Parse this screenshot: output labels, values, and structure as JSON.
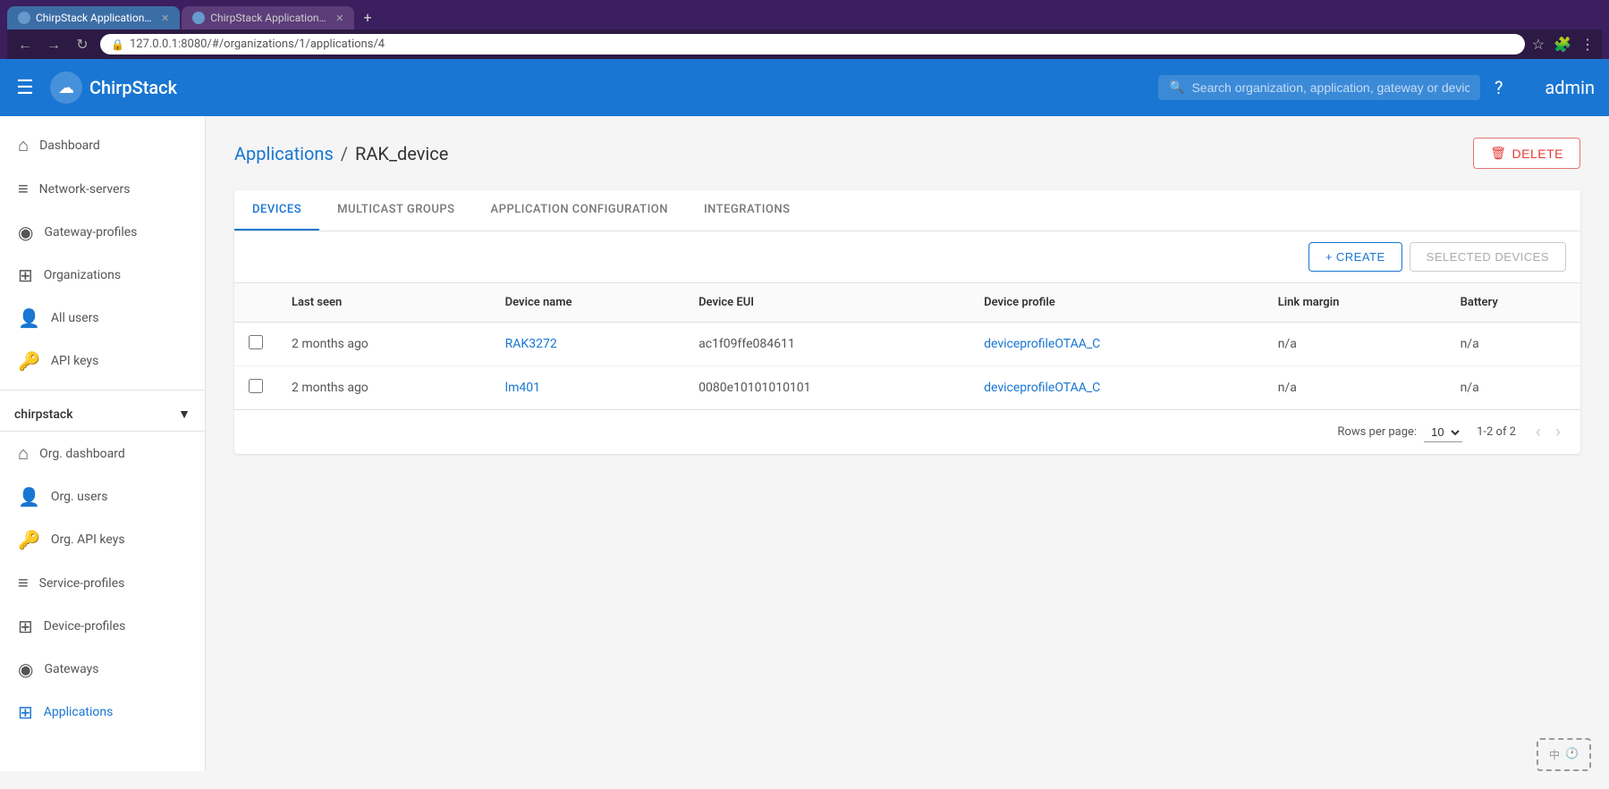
{
  "browser": {
    "tabs": [
      {
        "id": "tab1",
        "title": "ChirpStack Application S...",
        "active": true,
        "favicon": "🌐"
      },
      {
        "id": "tab2",
        "title": "ChirpStack Application S...",
        "active": false,
        "favicon": "🌐"
      }
    ],
    "address": "127.0.0.1:8080/#/organizations/1/applications/4",
    "new_tab_label": "+"
  },
  "appbar": {
    "logo_text": "ChirpStack",
    "search_placeholder": "Search organization, application, gateway or device",
    "user_label": "admin",
    "help_icon": "?",
    "menu_icon": "☰"
  },
  "sidebar": {
    "top_items": [
      {
        "id": "dashboard",
        "label": "Dashboard",
        "icon": "⌂"
      },
      {
        "id": "network-servers",
        "label": "Network-servers",
        "icon": "≡"
      },
      {
        "id": "gateway-profiles",
        "label": "Gateway-profiles",
        "icon": "◉"
      },
      {
        "id": "organizations",
        "label": "Organizations",
        "icon": "⊞"
      },
      {
        "id": "all-users",
        "label": "All users",
        "icon": "👤"
      },
      {
        "id": "api-keys",
        "label": "API keys",
        "icon": "🔑"
      }
    ],
    "org_selector": {
      "name": "chirpstack",
      "dropdown_icon": "▼"
    },
    "org_items": [
      {
        "id": "org-dashboard",
        "label": "Org. dashboard",
        "icon": "⌂"
      },
      {
        "id": "org-users",
        "label": "Org. users",
        "icon": "👤"
      },
      {
        "id": "org-api-keys",
        "label": "Org. API keys",
        "icon": "🔑"
      },
      {
        "id": "service-profiles",
        "label": "Service-profiles",
        "icon": "≡"
      },
      {
        "id": "device-profiles",
        "label": "Device-profiles",
        "icon": "⊞"
      },
      {
        "id": "gateways",
        "label": "Gateways",
        "icon": "◉"
      },
      {
        "id": "applications",
        "label": "Applications",
        "icon": "⊞",
        "active": true
      }
    ]
  },
  "breadcrumb": {
    "link_label": "Applications",
    "separator": "/",
    "current": "RAK_device"
  },
  "delete_button": {
    "label": "DELETE",
    "icon": "🗑"
  },
  "tabs": [
    {
      "id": "devices",
      "label": "DEVICES",
      "active": true
    },
    {
      "id": "multicast-groups",
      "label": "MULTICAST GROUPS",
      "active": false
    },
    {
      "id": "application-configuration",
      "label": "APPLICATION CONFIGURATION",
      "active": false
    },
    {
      "id": "integrations",
      "label": "INTEGRATIONS",
      "active": false
    }
  ],
  "toolbar": {
    "create_label": "CREATE",
    "selected_devices_label": "SELECTED DEVICES"
  },
  "table": {
    "columns": [
      {
        "id": "checkbox",
        "label": ""
      },
      {
        "id": "last-seen",
        "label": "Last seen"
      },
      {
        "id": "device-name",
        "label": "Device name"
      },
      {
        "id": "device-eui",
        "label": "Device EUI"
      },
      {
        "id": "device-profile",
        "label": "Device profile"
      },
      {
        "id": "link-margin",
        "label": "Link margin"
      },
      {
        "id": "battery",
        "label": "Battery"
      }
    ],
    "rows": [
      {
        "checkbox": false,
        "last_seen": "2 months ago",
        "device_name": "RAK3272",
        "device_eui": "ac1f09ffe084611",
        "device_profile": "deviceprofileOTAA_C",
        "link_margin": "n/a",
        "battery": "n/a"
      },
      {
        "checkbox": false,
        "last_seen": "2 months ago",
        "device_name": "lm401",
        "device_eui": "0080e10101010101",
        "device_profile": "deviceprofileOTAA_C",
        "link_margin": "n/a",
        "battery": "n/a"
      }
    ]
  },
  "pagination": {
    "rows_per_page_label": "Rows per page:",
    "rows_per_page": "10",
    "page_info": "1-2 of 2",
    "prev_disabled": true,
    "next_disabled": true
  }
}
